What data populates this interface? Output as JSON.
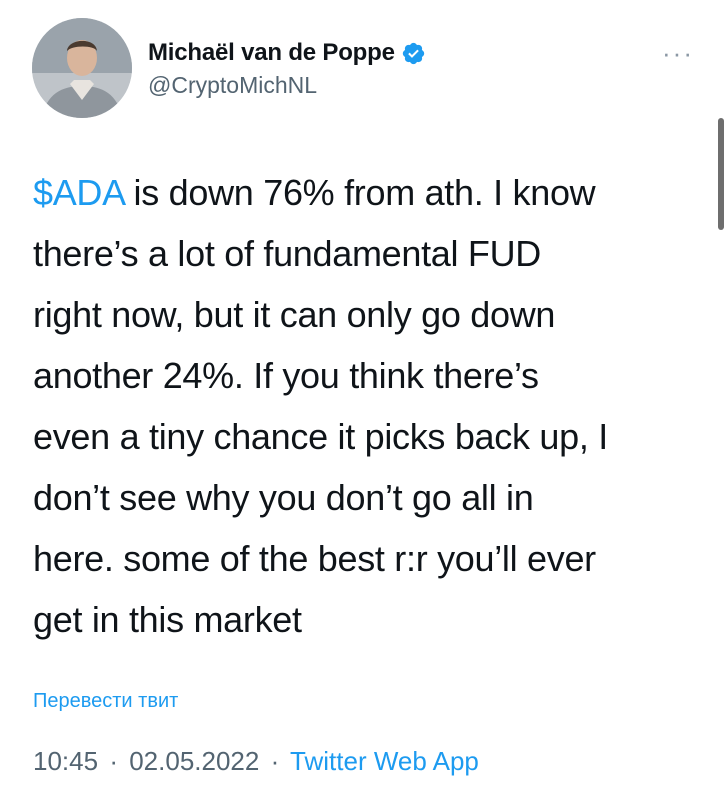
{
  "user": {
    "name": "Michaël van de Poppe",
    "handle": "@CryptoMichNL"
  },
  "tweet": {
    "cashtag": "$ADA",
    "lines": [
      " is down 76% from ath. I know",
      "there’s a lot of fundamental FUD",
      "right now, but it can only go down",
      "another 24%. If you think there’s",
      "even a tiny chance it picks back up, I",
      "don’t see why you don’t go all in",
      "here. some of the best r:r you’ll ever",
      "get in this market"
    ],
    "translate_label": "Перевести твит",
    "time": "10:45",
    "separator": "·",
    "date": "02.05.2022",
    "source_app": "Twitter Web App"
  },
  "more_label": "···",
  "colors": {
    "accent": "#1d9bf0",
    "text": "#0f1419",
    "muted": "#536471"
  },
  "icons": {
    "verified": "verified-badge-icon",
    "more": "more-options-icon"
  }
}
